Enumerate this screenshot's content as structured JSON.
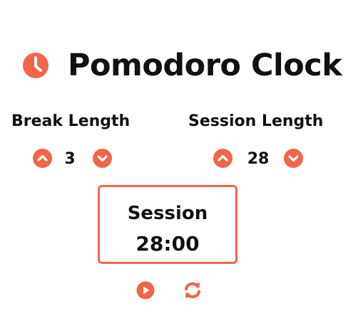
{
  "app": {
    "title": "Pomodoro Clock",
    "logo_icon": "clock-icon",
    "accent_color": "#f26548"
  },
  "break": {
    "label": "Break Length",
    "value": "3",
    "decrement_icon": "chevron-up-icon",
    "increment_icon": "chevron-down-icon"
  },
  "session": {
    "label": "Session Length",
    "value": "28",
    "decrement_icon": "chevron-up-icon",
    "increment_icon": "chevron-down-icon"
  },
  "timer": {
    "label": "Session",
    "time_left": "28:00"
  },
  "controls": {
    "start_stop_icon": "play-icon",
    "reset_icon": "refresh-icon"
  }
}
